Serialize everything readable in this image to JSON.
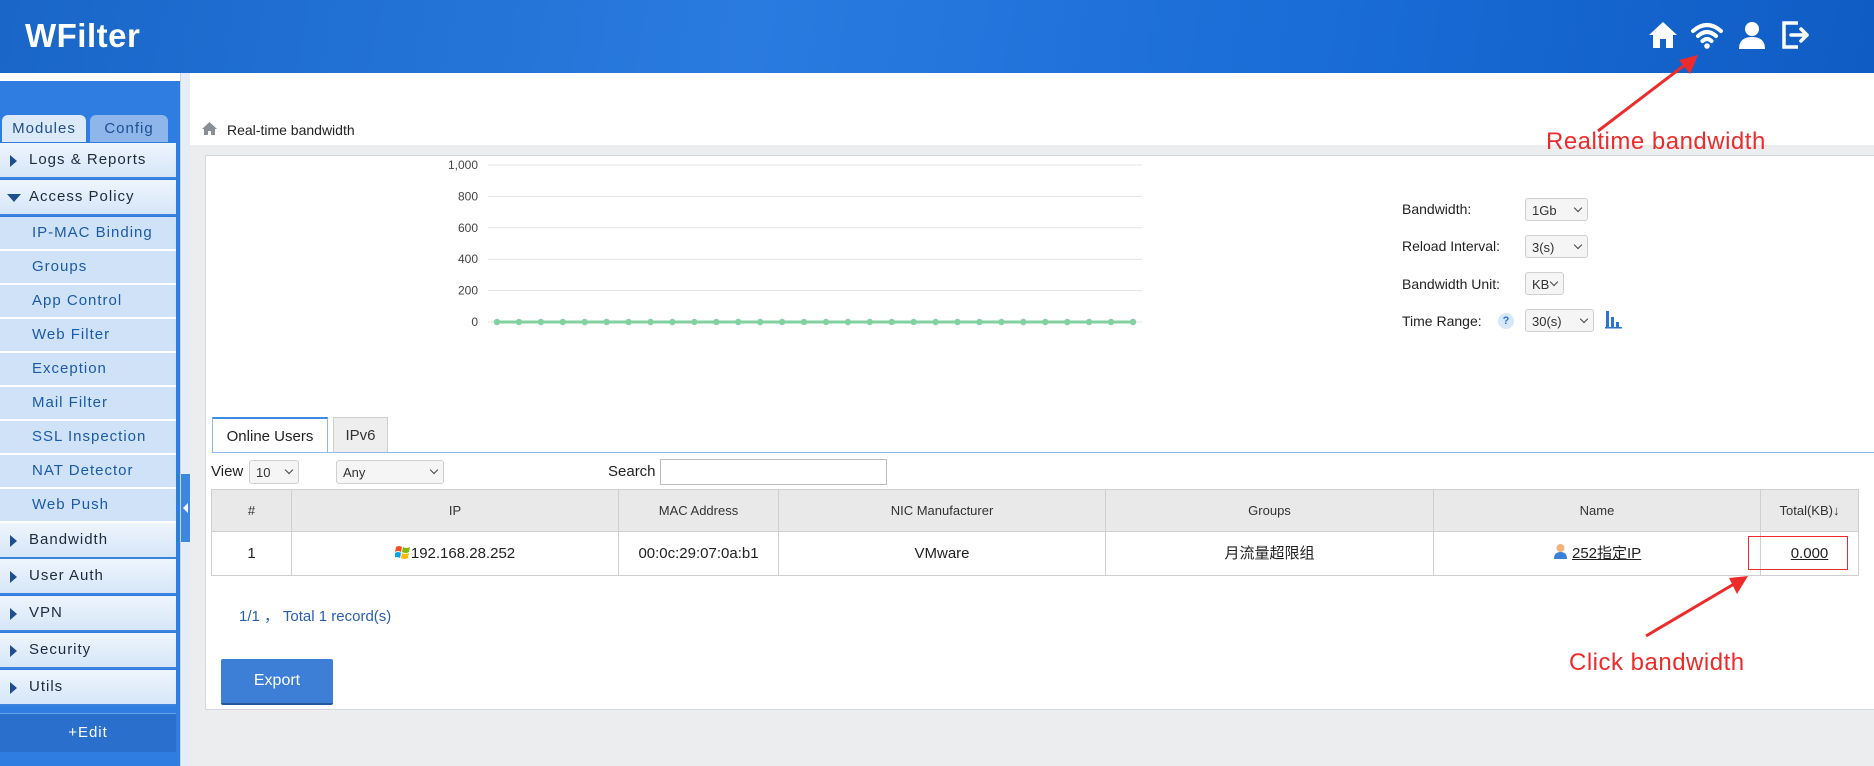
{
  "app": {
    "title": "WFilter"
  },
  "header": {
    "icons": [
      "home-icon",
      "wifi-icon",
      "user-icon",
      "logout-icon"
    ],
    "bg_color": "#1f6fd8"
  },
  "sidebar": {
    "tabs": [
      {
        "label": "Modules",
        "active": true
      },
      {
        "label": "Config",
        "active": false
      }
    ],
    "menu": [
      {
        "label": "Logs & Reports",
        "expanded": false
      },
      {
        "label": "Access Policy",
        "expanded": true,
        "children": [
          "IP-MAC Binding",
          "Groups",
          "App Control",
          "Web Filter",
          "Exception",
          "Mail Filter",
          "SSL Inspection",
          "NAT Detector",
          "Web Push"
        ]
      },
      {
        "label": "Bandwidth",
        "expanded": false
      },
      {
        "label": "User Auth",
        "expanded": false
      },
      {
        "label": "VPN",
        "expanded": false
      },
      {
        "label": "Security",
        "expanded": false
      },
      {
        "label": "Utils",
        "expanded": false
      }
    ],
    "edit_label": "+Edit"
  },
  "breadcrumb": {
    "label": "Real-time  bandwidth"
  },
  "chart_data": {
    "type": "line",
    "x": [
      1,
      2,
      3,
      4,
      5,
      6,
      7,
      8,
      9,
      10,
      11,
      12,
      13,
      14,
      15,
      16,
      17,
      18,
      19,
      20,
      21,
      22,
      23,
      24,
      25,
      26,
      27,
      28,
      29,
      30
    ],
    "series": [
      {
        "values": [
          0,
          0,
          0,
          0,
          0,
          0,
          0,
          0,
          0,
          0,
          0,
          0,
          0,
          0,
          0,
          0,
          0,
          0,
          0,
          0,
          0,
          0,
          0,
          0,
          0,
          0,
          0,
          0,
          0,
          0
        ],
        "color": "#82d1a0"
      }
    ],
    "ylim": [
      0,
      1000
    ],
    "yticks": [
      "1,000",
      "800",
      "600",
      "400",
      "200",
      "0"
    ],
    "grid": true
  },
  "controls": {
    "bandwidth": {
      "label": "Bandwidth:",
      "value": "1Gb"
    },
    "reload": {
      "label": "Reload  Interval:",
      "value": "3(s)"
    },
    "unit": {
      "label": "Bandwidth  Unit:",
      "value": "KB"
    },
    "time_range": {
      "label": "Time  Range:",
      "value": "30(s)",
      "help": "?"
    }
  },
  "tabs": [
    {
      "label": "Online  Users",
      "active": true
    },
    {
      "label": "IPv6",
      "active": false
    }
  ],
  "filters": {
    "view_label": "View",
    "view_value": "10",
    "group_value": "Any",
    "search_label": "Search",
    "search_value": ""
  },
  "table": {
    "columns": [
      "#",
      "IP",
      "MAC  Address",
      "NIC  Manufacturer",
      "Groups",
      "Name",
      "Total(KB)↓"
    ],
    "rows": [
      {
        "num": "1",
        "ip": "192.168.28.252",
        "mac": "00:0c:29:07:0a:b1",
        "nic": "VMware",
        "group": "月流量超限组",
        "name": "252指定IP",
        "total": "0.000"
      }
    ]
  },
  "pagination": {
    "text": "1/1 ， Total  1  record(s)"
  },
  "export_label": "Export",
  "annotations": {
    "realtime": "Realtime bandwidth",
    "click": "Click bandwidth",
    "color": "#ee2b2b"
  }
}
